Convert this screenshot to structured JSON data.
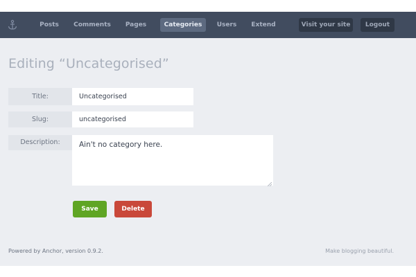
{
  "nav": {
    "items": [
      {
        "label": "Posts",
        "active": false
      },
      {
        "label": "Comments",
        "active": false
      },
      {
        "label": "Pages",
        "active": false
      },
      {
        "label": "Categories",
        "active": true
      },
      {
        "label": "Users",
        "active": false
      },
      {
        "label": "Extend",
        "active": false
      }
    ],
    "visit_site": "Visit your site",
    "logout": "Logout",
    "logo_icon": "anchor-icon"
  },
  "page": {
    "title": "Editing “Uncategorised”"
  },
  "form": {
    "title_label": "Title:",
    "title_value": "Uncategorised",
    "slug_label": "Slug:",
    "slug_value": "uncategorised",
    "description_label": "Description:",
    "description_value": "Ain't no category here.",
    "save": "Save",
    "delete": "Delete"
  },
  "footer": {
    "left": "Powered by Anchor, version 0.9.2.",
    "right": "Make blogging beautiful."
  },
  "colors": {
    "topbar": "#414c5f",
    "save": "#5fa524",
    "delete": "#c9483a",
    "background": "#eceef2"
  }
}
